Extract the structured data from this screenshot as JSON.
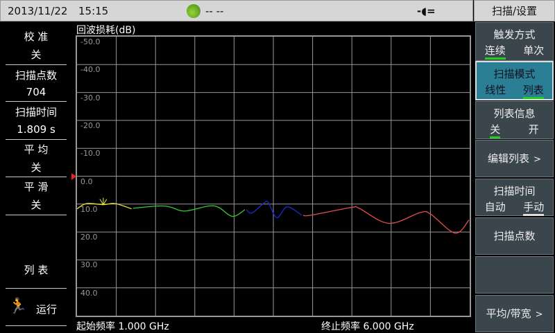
{
  "status": {
    "date": "2013/11/22",
    "time": "15:15",
    "signal_text": "-- --",
    "signal_icon": "satellite-icon",
    "power_icon": "plug-icon"
  },
  "menu_title": "扫描/设置",
  "left": {
    "calibration": {
      "label": "校 准",
      "value": "关"
    },
    "points": {
      "label": "扫描点数",
      "value": "704"
    },
    "sweep_time": {
      "label": "扫描时间",
      "value": "1.809 s"
    },
    "average": {
      "label": "平 均",
      "value": "关"
    },
    "smooth": {
      "label": "平 滑",
      "value": "关"
    },
    "list": "列 表",
    "run": "运行"
  },
  "menu": {
    "trigger": {
      "title": "触发方式",
      "opt1": "连续",
      "opt2": "单次",
      "selected": "连续"
    },
    "sweep_mode": {
      "title": "扫描模式",
      "opt1": "线性",
      "opt2": "列表",
      "selected": "列表"
    },
    "list_info": {
      "title": "列表信息",
      "opt1": "关",
      "opt2": "开",
      "selected": "关"
    },
    "edit_list": "编辑列表",
    "sweep_time": {
      "title": "扫描时间",
      "opt1": "自动",
      "opt2": "手动",
      "selected": "手动"
    },
    "sweep_points": "扫描点数",
    "avg_bw": "平均/带宽",
    "arrow": ">"
  },
  "chart_data": {
    "type": "line",
    "title": "回波损耗(dB)",
    "start_label": "起始频率 1.000 GHz",
    "stop_label": "终止频率 6.000 GHz",
    "xlim": [
      1.0,
      6.0
    ],
    "ylim": [
      -50,
      50
    ],
    "y_inverted_top": -50,
    "ytick_labels": [
      "-50.0",
      "-40.0",
      "-30.0",
      "-20.0",
      "-10.0",
      "0.0",
      "10.0",
      "20.0",
      "30.0",
      "40.0"
    ],
    "x_divisions": 10,
    "grid": true,
    "reference_level": 0,
    "marker": {
      "x": 1.335,
      "y": 10.2
    },
    "series": [
      {
        "name": "segment1",
        "color": "#e8e830",
        "x": [
          1.0,
          1.123,
          1.335,
          1.484,
          1.695
        ],
        "y": [
          11.7,
          9.8,
          10.2,
          9.8,
          11.7
        ]
      },
      {
        "name": "segment2",
        "color": "#33cc33",
        "x": [
          1.713,
          2.021,
          2.18,
          2.373,
          2.673,
          2.805,
          2.981,
          3.139
        ],
        "y": [
          11.5,
          10.7,
          11.0,
          12.5,
          10.7,
          11.2,
          14.4,
          12.0
        ]
      },
      {
        "name": "segment3",
        "color": "#1a2ad0",
        "x": [
          3.157,
          3.227,
          3.386,
          3.438,
          3.544,
          3.676,
          3.861
        ],
        "y": [
          12.0,
          13.2,
          9.5,
          9.5,
          14.9,
          11.0,
          14.0
        ]
      },
      {
        "name": "segment4",
        "color": "#e05050",
        "x": [
          3.879,
          3.975,
          4.495,
          4.592,
          4.97,
          5.375,
          5.507,
          5.815,
          5.991
        ],
        "y": [
          14.0,
          14.0,
          11.2,
          11.5,
          16.9,
          13.0,
          13.7,
          20.4,
          15.7
        ]
      }
    ]
  }
}
